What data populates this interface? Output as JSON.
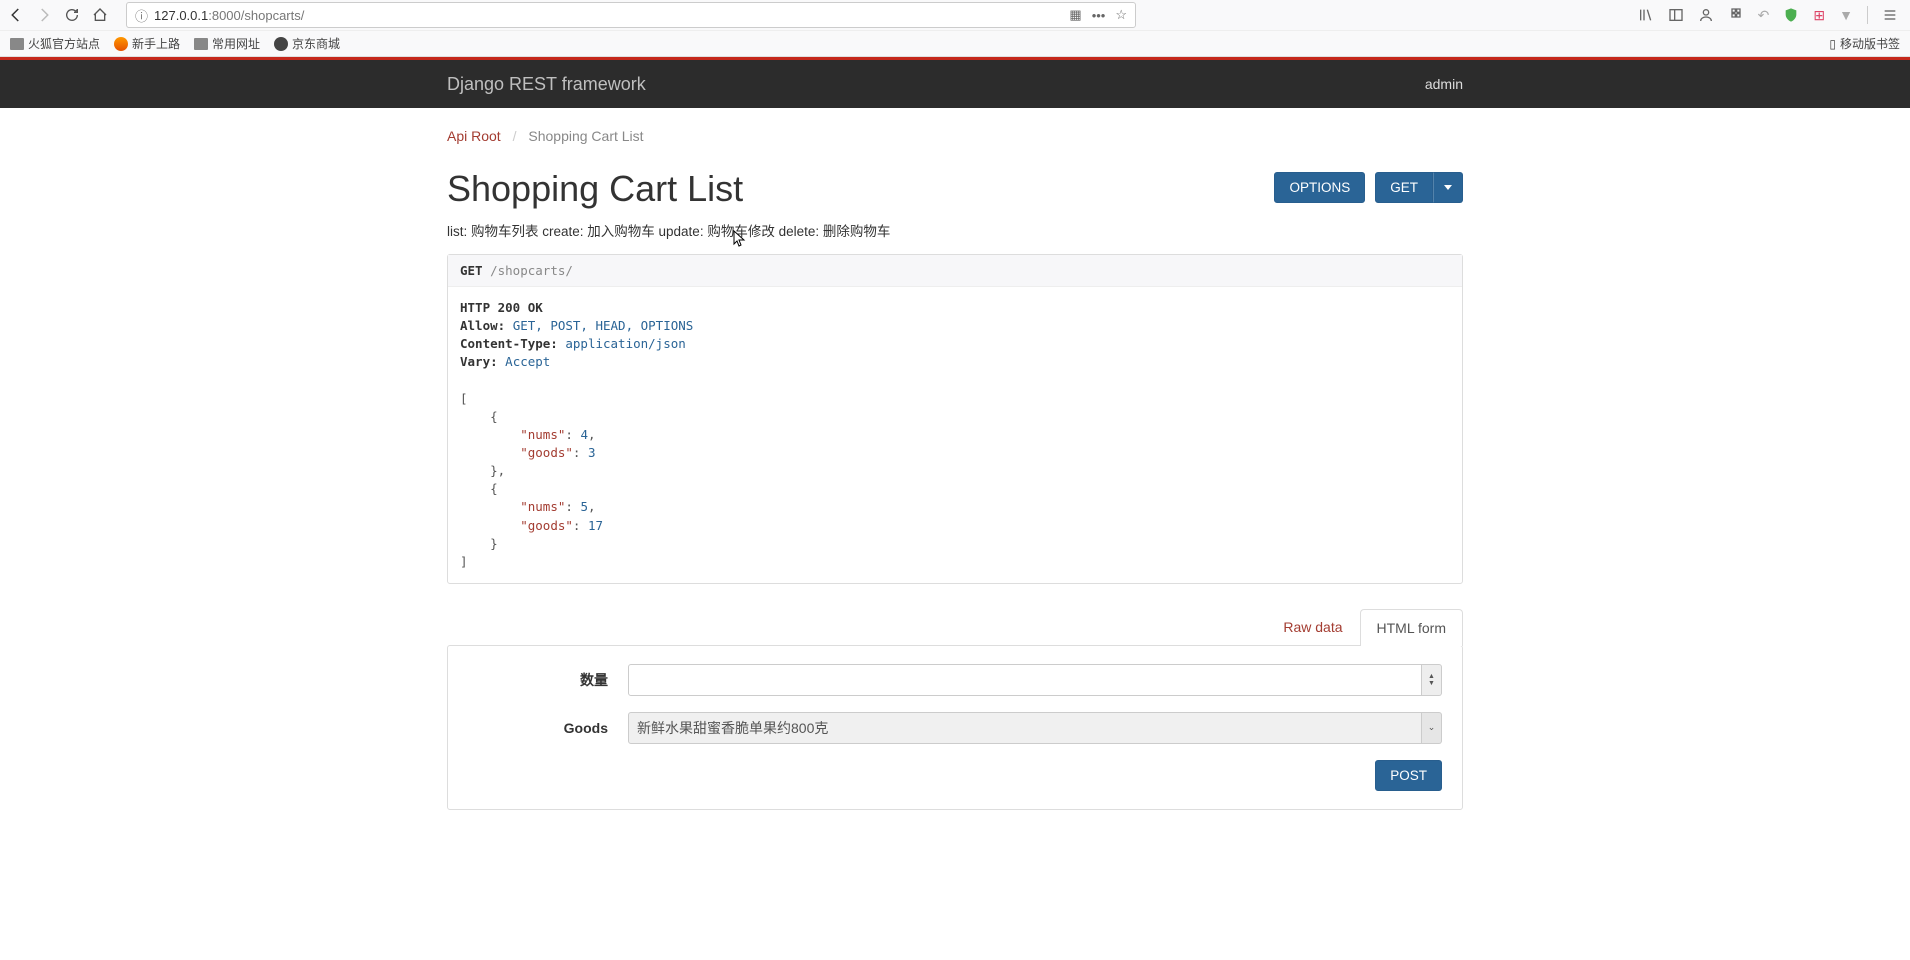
{
  "browser": {
    "url_prefix": "127.0.0.1",
    "url_port_path": ":8000/shopcarts/",
    "bookmarks": {
      "b1": "火狐官方站点",
      "b2": "新手上路",
      "b3": "常用网址",
      "b4": "京东商城"
    },
    "mobile_bookmarks": "移动版书签"
  },
  "nav": {
    "brand": "Django REST framework",
    "user": "admin"
  },
  "breadcrumb": {
    "root": "Api Root",
    "current": "Shopping Cart List"
  },
  "page": {
    "title": "Shopping Cart List",
    "description": "list: 购物车列表 create: 加入购物车 update: 购物车修改 delete: 删除购物车"
  },
  "buttons": {
    "options": "OPTIONS",
    "get": "GET",
    "post": "POST"
  },
  "request": {
    "method": "GET",
    "path": "/shopcarts/"
  },
  "response": {
    "status_line": "HTTP 200 OK",
    "headers": {
      "allow_label": "Allow:",
      "allow_value": "GET, POST, HEAD, OPTIONS",
      "ctype_label": "Content-Type:",
      "ctype_value": "application/json",
      "vary_label": "Vary:",
      "vary_value": "Accept"
    },
    "body": [
      {
        "nums": 4,
        "goods": 3
      },
      {
        "nums": 5,
        "goods": 17
      }
    ]
  },
  "tabs": {
    "raw": "Raw data",
    "html": "HTML form"
  },
  "form": {
    "qty_label": "数量",
    "goods_label": "Goods",
    "goods_value": "新鲜水果甜蜜香脆单果约800克"
  }
}
